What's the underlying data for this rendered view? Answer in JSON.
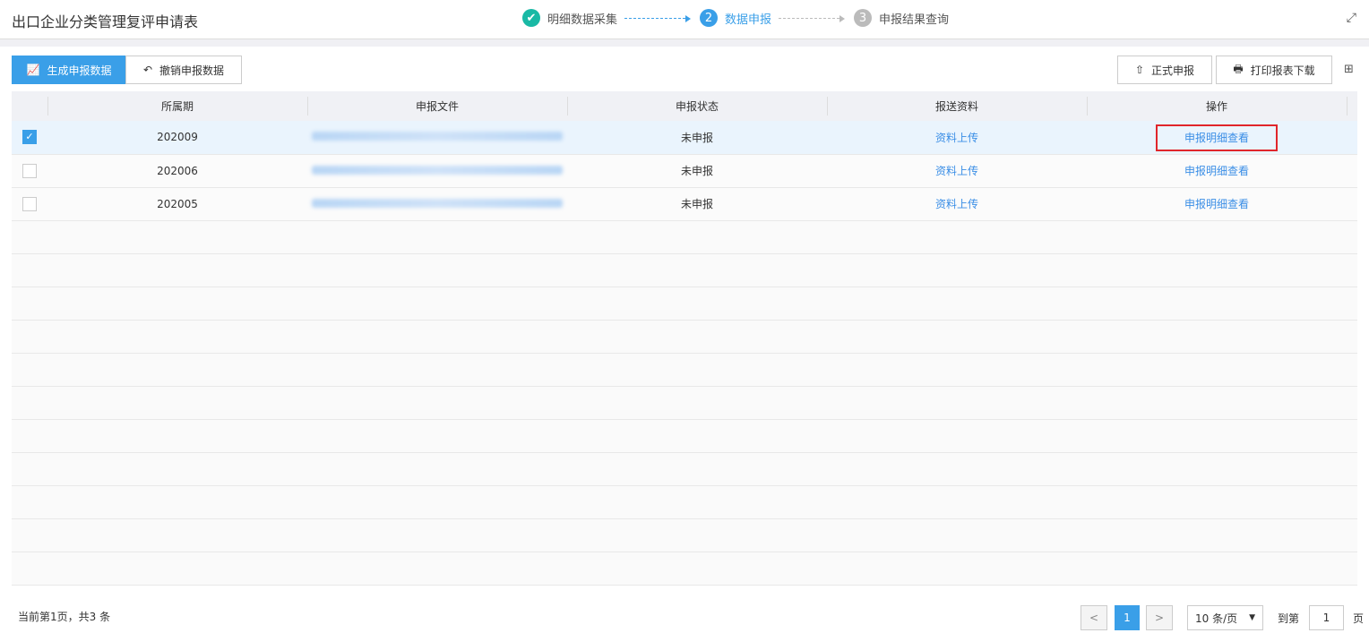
{
  "header": {
    "title": "出口企业分类管理复评申请表",
    "steps": [
      {
        "num": "✔",
        "label": "明细数据采集"
      },
      {
        "num": "2",
        "label": "数据申报"
      },
      {
        "num": "3",
        "label": "申报结果查询"
      }
    ],
    "expand_icon": "⤢"
  },
  "toolbar": {
    "generate": "生成申报数据",
    "revoke": "撤销申报数据",
    "submit": "正式申报",
    "print": "打印报表下载"
  },
  "table": {
    "columns": [
      "所属期",
      "申报文件",
      "申报状态",
      "报送资料",
      "操作"
    ],
    "rows": [
      {
        "period": "202009",
        "status": "未申报",
        "upload": "资料上传",
        "action": "申报明细查看",
        "checked": true
      },
      {
        "period": "202006",
        "status": "未申报",
        "upload": "资料上传",
        "action": "申报明细查看",
        "checked": false
      },
      {
        "period": "202005",
        "status": "未申报",
        "upload": "资料上传",
        "action": "申报明细查看",
        "checked": false
      }
    ]
  },
  "footer": {
    "summary": "当前第1页，共3 条",
    "page": "1",
    "page_size": "10 条/页",
    "goto_label": "到第",
    "goto_value": "1",
    "page_unit": "页"
  },
  "colors": {
    "accent": "#3a9fe8",
    "done": "#19b9a5",
    "inactive": "#bbbbbb"
  }
}
